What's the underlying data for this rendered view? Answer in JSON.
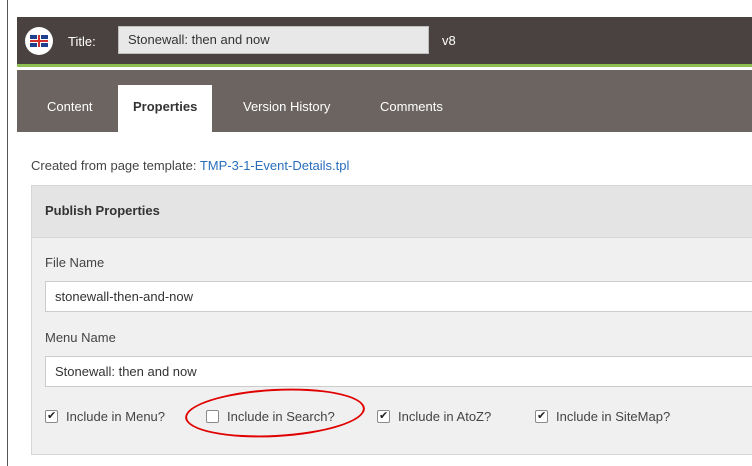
{
  "header": {
    "title_label": "Title:",
    "title_value": "Stonewall: then and now",
    "version": "v8",
    "flag_icon": "uk-flag-icon"
  },
  "tabs": [
    {
      "label": "Content",
      "active": false
    },
    {
      "label": "Properties",
      "active": true
    },
    {
      "label": "Version History",
      "active": false
    },
    {
      "label": "Comments",
      "active": false
    }
  ],
  "template": {
    "prefix": "Created from page template: ",
    "link": "TMP-3-1-Event-Details.tpl"
  },
  "publish": {
    "heading": "Publish Properties",
    "file_name_label": "File Name",
    "file_name_value": "stonewall-then-and-now",
    "menu_name_label": "Menu Name",
    "menu_name_value": "Stonewall: then and now",
    "checkboxes": [
      {
        "label": "Include in Menu?",
        "checked": true
      },
      {
        "label": "Include in Search?",
        "checked": false
      },
      {
        "label": "Include in AtoZ?",
        "checked": true
      },
      {
        "label": "Include in SiteMap?",
        "checked": true
      }
    ]
  },
  "colors": {
    "topbar": "#4a4240",
    "accent": "#8cc152",
    "tabbar": "#6b6461",
    "link": "#2a6ebb",
    "annotation": "#e00000"
  }
}
